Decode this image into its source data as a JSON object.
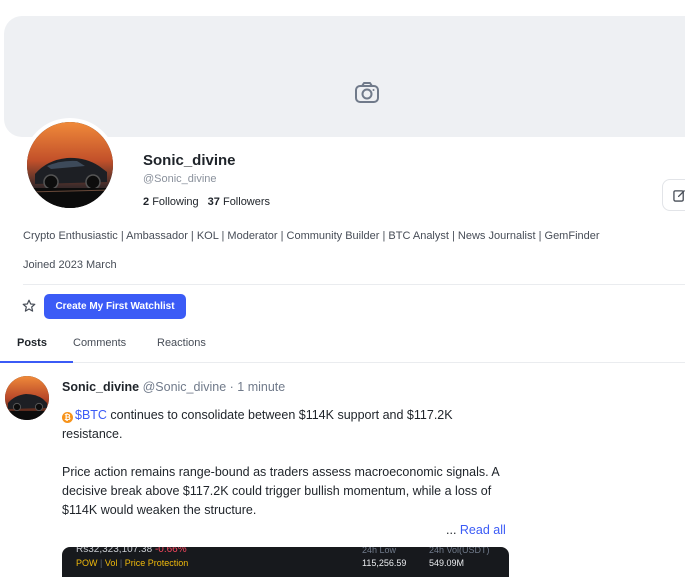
{
  "profile": {
    "display_name": "Sonic_divine",
    "handle": "@Sonic_divine",
    "following_count": "2",
    "following_label": "Following",
    "followers_count": "37",
    "followers_label": "Followers",
    "bio": "Crypto Enthusiastic | Ambassador | KOL | Moderator | Community Builder | BTC Analyst | News Journalist | GemFinder",
    "joined": "Joined 2023 March",
    "watchlist_button": "Create My First Watchlist"
  },
  "tabs": [
    {
      "label": "Posts",
      "active": true
    },
    {
      "label": "Comments",
      "active": false
    },
    {
      "label": "Reactions",
      "active": false
    }
  ],
  "post": {
    "author": "Sonic_divine",
    "handle": "@Sonic_divine",
    "time": "· 1 minute",
    "coin_symbol": "₿",
    "cashtag": "$BTC",
    "line1_rest": " continues to consolidate between $114K support and $117.2K resistance.",
    "paragraph2": "Price action remains range-bound as traders assess macroeconomic signals. A decisive break above $117.2K could trigger bullish momentum, while a loss of $114K would weaken the structure.",
    "ellipsis": "...",
    "read_all": "Read all",
    "media": {
      "price": "Rs32,323,107.38",
      "change": "-0.66%",
      "tag1": "POW",
      "tag2": "Vol",
      "tag3": "Price Protection",
      "low_label": "24h Low",
      "low_value": "115,256.59",
      "vol_label": "24h Vol(USDT)",
      "vol_value": "549.09M"
    }
  },
  "colors": {
    "accent": "#3b5bf6",
    "banner": "#eef0f3",
    "negative": "#f6465d",
    "btc": "#f7931a"
  },
  "icons": [
    "camera-icon",
    "edit-icon",
    "star-icon",
    "btc-coin-icon"
  ]
}
